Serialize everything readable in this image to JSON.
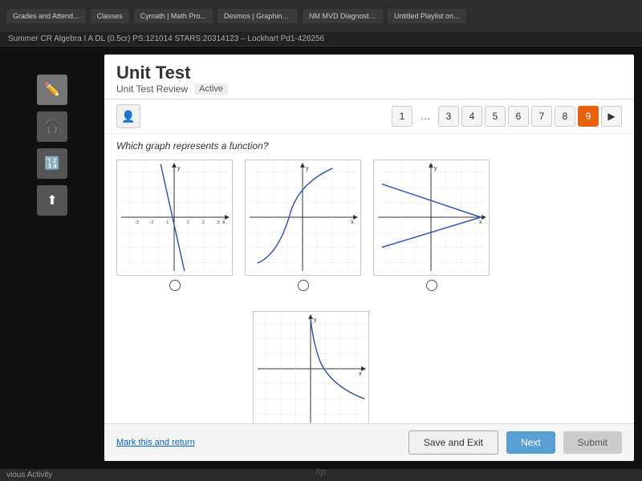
{
  "browser": {
    "tabs": [
      {
        "label": "Grades and Attend..."
      },
      {
        "label": "Classes"
      },
      {
        "label": "Cymath | Math Pro..."
      },
      {
        "label": "Desmos | Graphing..."
      },
      {
        "label": "NM MVD Diagnosti..."
      },
      {
        "label": "Untitled Playlist on..."
      }
    ]
  },
  "classbar": {
    "text": "Summer CR Algebra I A DL (0.5cr) PS:121014 STARS:20314123 – Lockhart Pd1-426256"
  },
  "header": {
    "title": "Unit Test",
    "subtitle": "Unit Test Review",
    "status": "Active"
  },
  "pagination": {
    "pages": [
      "1",
      "…",
      "3",
      "4",
      "5",
      "6",
      "7",
      "8",
      "9"
    ],
    "active": "9",
    "next_arrow": "▶"
  },
  "question": {
    "text": "Which graph represents a function?"
  },
  "graphs": [
    {
      "id": 1,
      "type": "linear_steep"
    },
    {
      "id": 2,
      "type": "curve_up"
    },
    {
      "id": 3,
      "type": "v_shape"
    },
    {
      "id": 4,
      "type": "decay_curve"
    }
  ],
  "bottom": {
    "mark_return": "Mark this and return",
    "save_exit": "Save and Exit",
    "next": "Next",
    "submit": "Submit"
  },
  "statusbar": {
    "activity": "vious Activity"
  },
  "hp_logo": "hp"
}
